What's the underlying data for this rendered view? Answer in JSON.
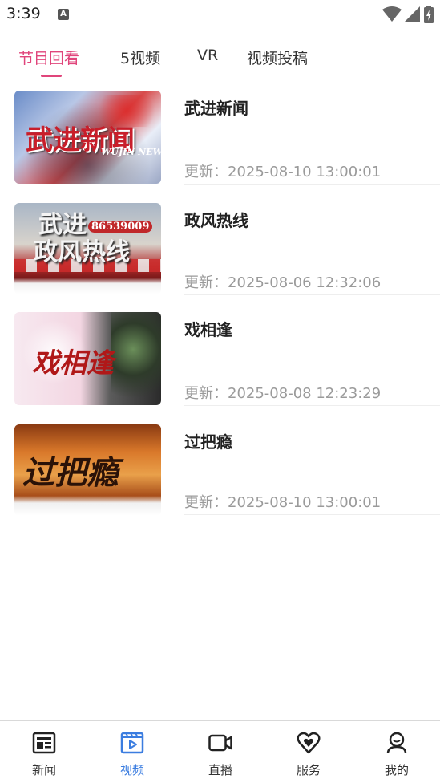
{
  "status_bar": {
    "time": "3:39",
    "notification_icon": "A"
  },
  "tabs": [
    {
      "label": "节目回看",
      "active": true
    },
    {
      "label": "5视频",
      "active": false
    },
    {
      "label": "VR",
      "active": false
    },
    {
      "label": "视频投稿",
      "active": false
    }
  ],
  "accent_color": "#e0457b",
  "nav_active_color": "#3b7de0",
  "programs": [
    {
      "title": "武进新闻",
      "updated": "更新：2025-08-10 13:00:01",
      "thumbnail": {
        "icon": "wujin-news-thumbnail",
        "text": "武进新闻",
        "subtext": "WUJIN NEWS"
      }
    },
    {
      "title": "政风热线",
      "updated": "更新：2025-08-06 12:32:06",
      "thumbnail": {
        "icon": "zhengfeng-hotline-thumbnail",
        "text_top": "武进",
        "text_bottom": "政风热线",
        "phone": "86539009"
      }
    },
    {
      "title": "戏相逢",
      "updated": "更新：2025-08-08 12:23:29",
      "thumbnail": {
        "icon": "xixiangfeng-thumbnail",
        "text": "戏相逢"
      }
    },
    {
      "title": "过把瘾",
      "updated": "更新：2025-08-10 13:00:01",
      "thumbnail": {
        "icon": "guobayin-thumbnail",
        "text": "过把瘾"
      }
    }
  ],
  "bottom_nav": [
    {
      "label": "新闻",
      "icon": "newspaper-icon",
      "active": false
    },
    {
      "label": "视频",
      "icon": "video-play-icon",
      "active": true
    },
    {
      "label": "直播",
      "icon": "camera-live-icon",
      "active": false
    },
    {
      "label": "服务",
      "icon": "heart-service-icon",
      "active": false
    },
    {
      "label": "我的",
      "icon": "profile-icon",
      "active": false
    }
  ]
}
